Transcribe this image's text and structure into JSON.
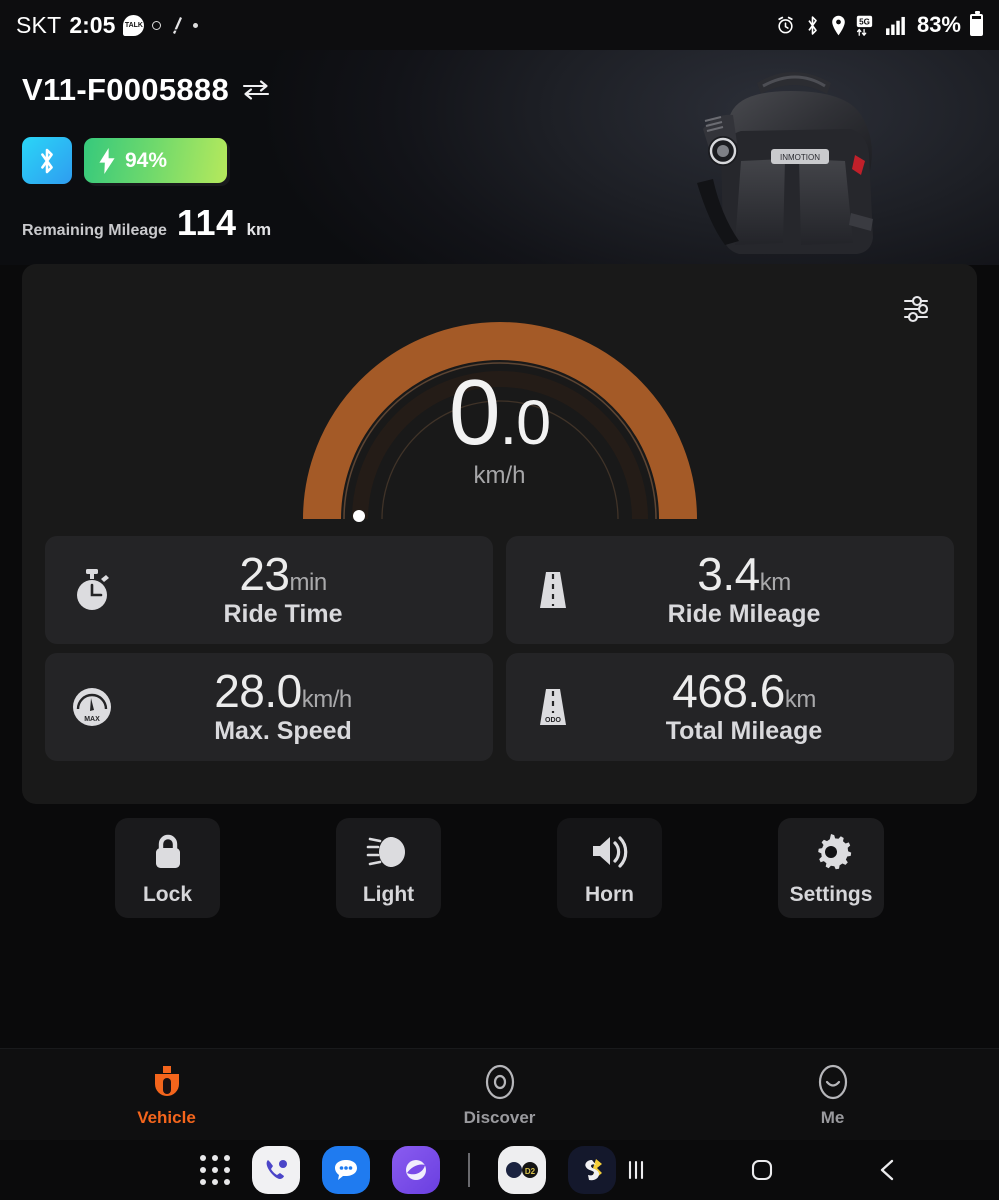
{
  "statusbar": {
    "carrier": "SKT",
    "time": "2:05",
    "kakao_label": "TALK",
    "battery_percent": "83%",
    "icons": [
      "kakaotalk-icon",
      "dot-ring-icon",
      "note-icon",
      "dot-icon",
      "alarm-icon",
      "bluetooth-icon",
      "location-icon",
      "5g-icon",
      "signal-icon",
      "battery-icon"
    ]
  },
  "hero": {
    "device_name": "V11-F0005888",
    "switch_icon": "switch-device-icon",
    "bluetooth_icon": "bluetooth-icon",
    "battery_percent": "94%",
    "charge_icon": "lightning-bolt-icon",
    "remaining_label": "Remaining Mileage",
    "remaining_value": "114",
    "remaining_unit": "km",
    "vehicle_image": "electric-unicycle-image"
  },
  "dashboard": {
    "settings_sliders_icon": "sliders-icon",
    "speed_value": "0",
    "speed_decimal": ".0",
    "speed_unit": "km/h",
    "gauge": {
      "min": 0,
      "max": 50,
      "current": 0.0,
      "arc_color": "#a45a27",
      "track_color": "#221b17",
      "marker_color": "#ffffff"
    },
    "tiles": [
      {
        "icon": "stopwatch-icon",
        "value": "23",
        "unit": "min",
        "label": "Ride Time"
      },
      {
        "icon": "road-icon",
        "value": "3.4",
        "unit": "km",
        "label": "Ride Mileage"
      },
      {
        "icon": "max-speed-gauge-icon",
        "value": "28.0",
        "unit": "km/h",
        "label": "Max. Speed"
      },
      {
        "icon": "odometer-road-icon",
        "value": "468.6",
        "unit": "km",
        "label": "Total Mileage"
      }
    ]
  },
  "actions": [
    {
      "icon": "lock-icon",
      "label": "Lock"
    },
    {
      "icon": "headlight-icon",
      "label": "Light"
    },
    {
      "icon": "horn-icon",
      "label": "Horn"
    },
    {
      "icon": "gear-icon",
      "label": "Settings"
    }
  ],
  "tabs": [
    {
      "icon": "unicycle-icon",
      "label": "Vehicle",
      "active": true
    },
    {
      "icon": "compass-icon",
      "label": "Discover",
      "active": false
    },
    {
      "icon": "smiley-icon",
      "label": "Me",
      "active": false
    }
  ],
  "taskbar": {
    "apps": [
      "app-drawer-icon",
      "phone-icon",
      "messages-icon",
      "internet-icon",
      "folder-icon",
      "samsung-app-icon"
    ],
    "nav": [
      "recents-icon",
      "home-icon",
      "back-icon"
    ]
  },
  "colors": {
    "accent_orange": "#f4651c",
    "gauge_orange": "#a45a27",
    "battery_green_start": "#36c97c",
    "battery_green_end": "#b6e95c",
    "bluetooth_blue": "#2f9cf0",
    "card_bg": "#191919",
    "tile_bg": "#242426"
  }
}
